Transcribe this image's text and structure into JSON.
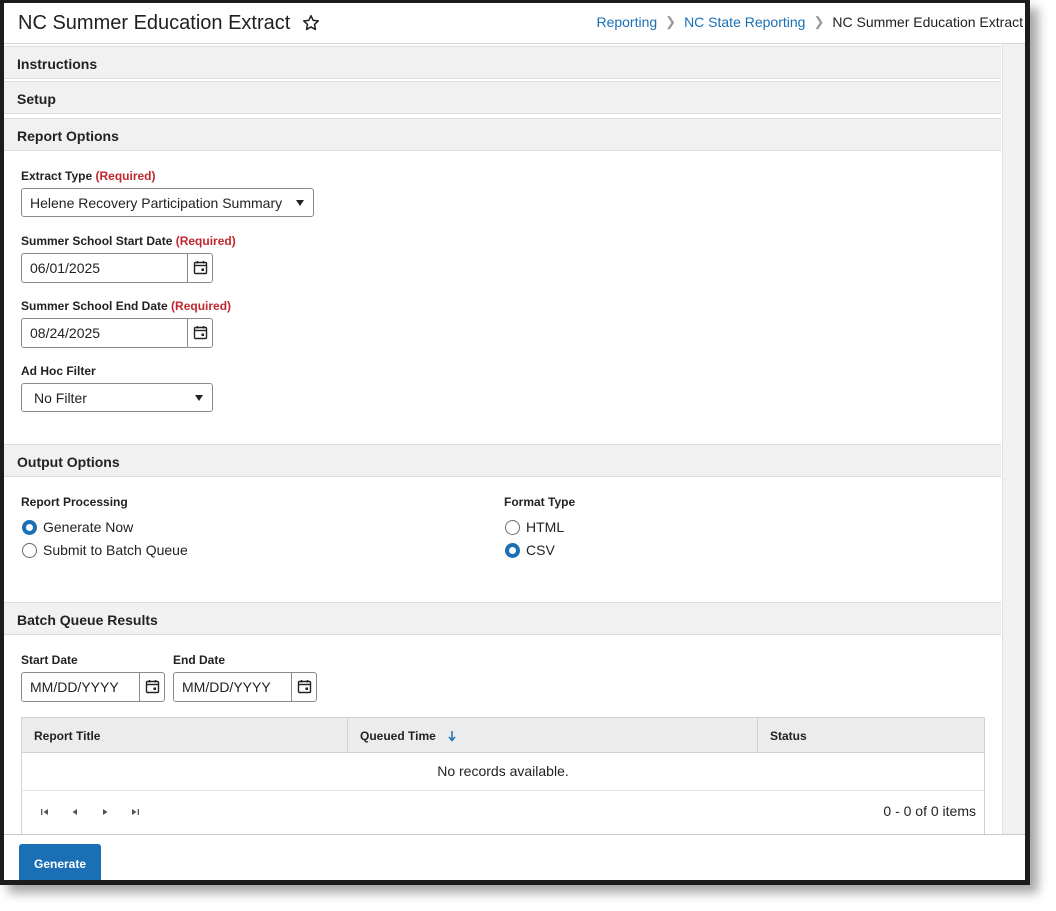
{
  "header": {
    "title": "NC Summer Education Extract",
    "breadcrumb": [
      "Reporting",
      "NC State Reporting",
      "NC Summer Education Extract"
    ]
  },
  "sections": {
    "instructions": "Instructions",
    "setup": "Setup",
    "report_options": "Report Options",
    "output_options": "Output Options",
    "batch_queue": "Batch Queue Results"
  },
  "report_options": {
    "required_text": "(Required)",
    "extract_type_label": "Extract Type",
    "extract_type_value": "Helene Recovery Participation Summary",
    "start_date_label": "Summer School Start Date",
    "start_date_value": "06/01/2025",
    "end_date_label": "Summer School End Date",
    "end_date_value": "08/24/2025",
    "ad_hoc_label": "Ad Hoc Filter",
    "ad_hoc_value": "No Filter"
  },
  "output_options": {
    "processing_label": "Report Processing",
    "processing_options": [
      {
        "label": "Generate Now",
        "checked": true
      },
      {
        "label": "Submit to Batch Queue",
        "checked": false
      }
    ],
    "format_label": "Format Type",
    "format_options": [
      {
        "label": "HTML",
        "checked": false
      },
      {
        "label": "CSV",
        "checked": true
      }
    ]
  },
  "batch_queue": {
    "start_date_label": "Start Date",
    "end_date_label": "End Date",
    "date_placeholder": "MM/DD/YYYY",
    "columns": [
      "Report Title",
      "Queued Time",
      "Status"
    ],
    "empty_text": "No records available.",
    "pager_info": "0 - 0 of 0 items"
  },
  "footer": {
    "generate_label": "Generate"
  },
  "colors": {
    "accent": "#1a6fb5",
    "required": "#c0272d",
    "section_bg": "#f1f1f1"
  }
}
